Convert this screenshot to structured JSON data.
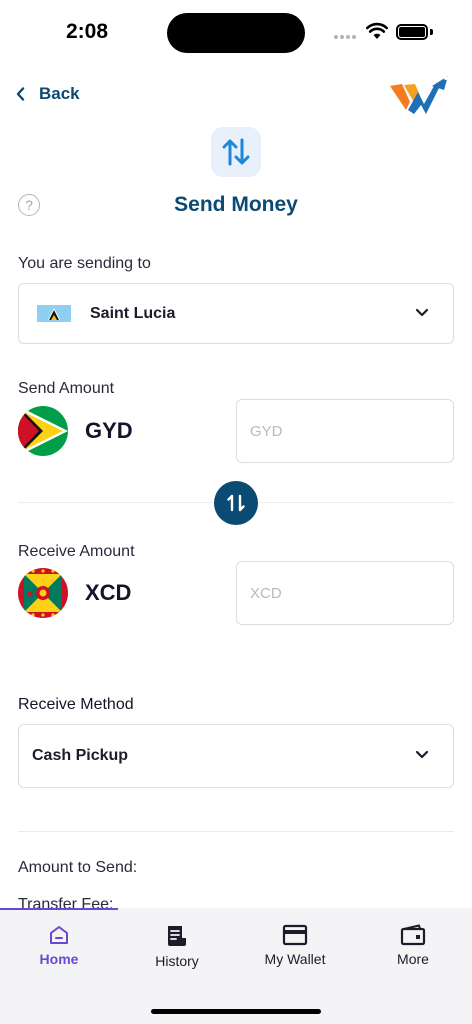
{
  "status_bar": {
    "time": "2:08"
  },
  "header": {
    "back_label": "Back",
    "title": "Send Money"
  },
  "destination": {
    "label": "You are  sending to",
    "country": "Saint Lucia"
  },
  "send": {
    "label": "Send Amount",
    "currency": "GYD",
    "placeholder": "GYD"
  },
  "receive": {
    "label": "Receive Amount",
    "currency": "XCD",
    "placeholder": "XCD"
  },
  "method": {
    "label": "Receive Method",
    "value": "Cash Pickup"
  },
  "summary": {
    "amount_to_send_label": "Amount to Send:",
    "transfer_fee_label": "Transfer Fee:"
  },
  "tabs": [
    {
      "label": "Home",
      "icon": "home-icon",
      "active": true
    },
    {
      "label": "History",
      "icon": "receipt-icon",
      "active": false
    },
    {
      "label": "My Wallet",
      "icon": "card-icon",
      "active": false
    },
    {
      "label": "More",
      "icon": "wallet-icon",
      "active": false
    }
  ],
  "colors": {
    "primary": "#0b4a73",
    "accent": "#6b47d6",
    "border": "#dcdde3"
  }
}
